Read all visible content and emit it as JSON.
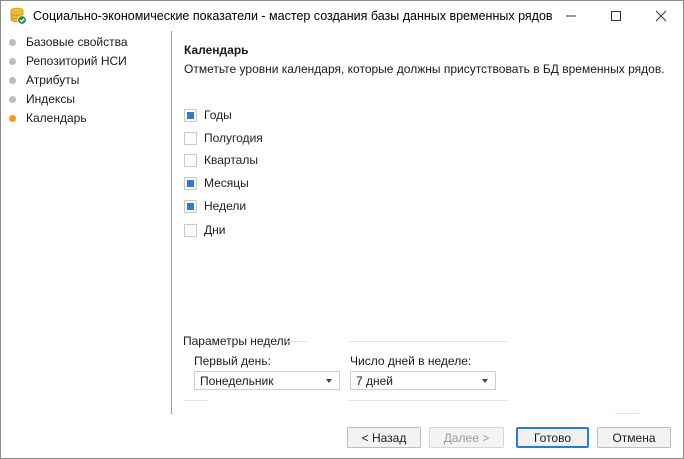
{
  "window": {
    "title": "Социально-экономические показатели - мастер создания базы данных временных рядов"
  },
  "sidebar": {
    "items": [
      {
        "label": "Базовые свойства",
        "active": false
      },
      {
        "label": "Репозиторий НСИ",
        "active": false
      },
      {
        "label": "Атрибуты",
        "active": false
      },
      {
        "label": "Индексы",
        "active": false
      },
      {
        "label": "Календарь",
        "active": true
      }
    ]
  },
  "main": {
    "heading": "Календарь",
    "description": "Отметьте уровни календаря, которые должны присутствовать в БД временных рядов.",
    "levels": [
      {
        "label": "Годы",
        "checked": true
      },
      {
        "label": "Полугодия",
        "checked": false
      },
      {
        "label": "Кварталы",
        "checked": false
      },
      {
        "label": "Месяцы",
        "checked": true
      },
      {
        "label": "Недели",
        "checked": true
      },
      {
        "label": "Дни",
        "checked": false
      }
    ],
    "week_params": {
      "title": "Параметры недели",
      "first_day_label": "Первый день:",
      "first_day_value": "Понедельник",
      "days_in_week_label": "Число дней в неделе:",
      "days_in_week_value": "7 дней"
    }
  },
  "footer": {
    "back": "< Назад",
    "next": "Далее >",
    "finish": "Готово",
    "cancel": "Отмена"
  },
  "colors": {
    "accent": "#2a7bd3",
    "active_step": "#f29a1d",
    "inactive_step": "#b8bcc4"
  },
  "icons": {
    "app": "database-icon",
    "minimize": "minimize-icon",
    "maximize": "maximize-icon",
    "close": "close-icon"
  }
}
